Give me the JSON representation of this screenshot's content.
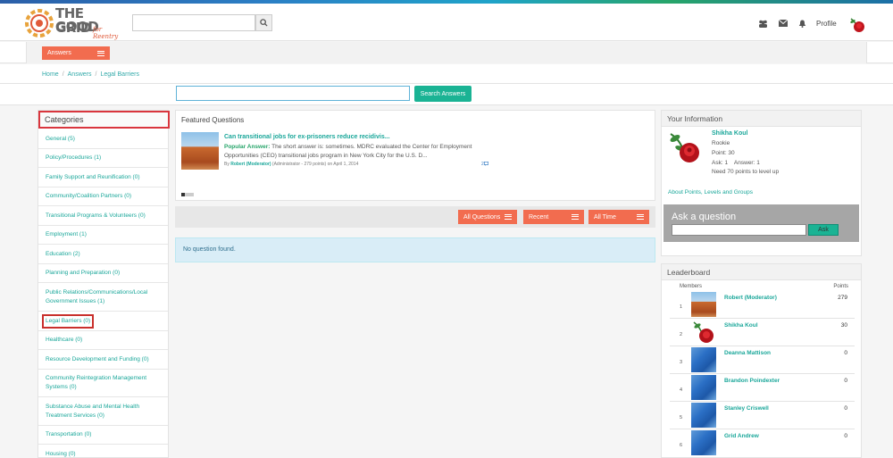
{
  "logo": {
    "line1": "THE GOOD",
    "line2": "GRID",
    "script": "for Reentry"
  },
  "header": {
    "search_placeholder": "",
    "profile_label": "Profile"
  },
  "subnav": {
    "answers_label": "Answers"
  },
  "breadcrumb": {
    "items": [
      "Home",
      "Answers",
      "Legal Barriers"
    ]
  },
  "search": {
    "placeholder": "",
    "button_label": "Search Answers"
  },
  "categories": {
    "title": "Categories",
    "items": [
      "General (5)",
      "Policy/Procedures (1)",
      "Family Support and Reunification (0)",
      "Community/Coalition Partners (0)",
      "Transitional Programs & Volunteers (0)",
      "Employment (1)",
      "Education (2)",
      "Planning and Preparation (0)",
      "Public Relations/Communications/Local Government Issues (1)",
      "Legal Barriers (0)",
      "Healthcare (0)",
      "Resource Development and Funding (0)",
      "Community Reintegration Management Systems (0)",
      "Substance Abuse and Mental Health Treatment Services (0)",
      "Transportation (0)",
      "Housing (0)"
    ]
  },
  "featured": {
    "title": "Featured Questions",
    "question": "Can transitional jobs for ex-prisoners reduce recidivis...",
    "answer_label": "Popular Answer:",
    "answer_text": " The short answer is: sometimes. MDRC evaluated the Center for Employment Opportunities (CEO) transitional jobs program in New York City for the U.S. D...",
    "meta_by": "By",
    "meta_author": "Robert (Moderator)",
    "meta_rest": "(Administrator - 279 points)  on April 1, 2014",
    "answer_count": "2"
  },
  "filters": {
    "all_questions": "All Questions",
    "recent": "Recent",
    "all_time": "All Time"
  },
  "empty_message": "No question found.",
  "your_info": {
    "title": "Your Information",
    "name": "Shikha Koul",
    "rank": "Rookie",
    "points": "Point: 30",
    "ask_answer": "Ask: 1    Answer: 1",
    "need": "Need 70 points to level up",
    "about_link": "About Points, Levels and Groups"
  },
  "ask": {
    "title": "Ask a question",
    "button_label": "Ask",
    "placeholder": ""
  },
  "leaderboard": {
    "title": "Leaderboard",
    "col_members": "Members",
    "col_points": "Points",
    "rows": [
      {
        "rank": "1",
        "name": "Robert (Moderator)",
        "points": "279",
        "avatar": "mesa"
      },
      {
        "rank": "2",
        "name": "Shikha Koul",
        "points": "30",
        "avatar": "rose"
      },
      {
        "rank": "3",
        "name": "Deanna Mattison",
        "points": "0",
        "avatar": "blue"
      },
      {
        "rank": "4",
        "name": "Brandon Poindexter",
        "points": "0",
        "avatar": "blue"
      },
      {
        "rank": "5",
        "name": "Stanley Criswell",
        "points": "0",
        "avatar": "blue"
      },
      {
        "rank": "6",
        "name": "Grid Andrew",
        "points": "0",
        "avatar": "blue"
      }
    ]
  },
  "icons": {
    "search": "search-icon",
    "users": "users-icon",
    "mail": "envelope-icon",
    "bell": "bell-icon",
    "menu": "menu-icon"
  },
  "colors": {
    "accent_orange": "#f26c4f",
    "accent_teal": "#1ab394",
    "link_teal": "#1aa79a"
  }
}
